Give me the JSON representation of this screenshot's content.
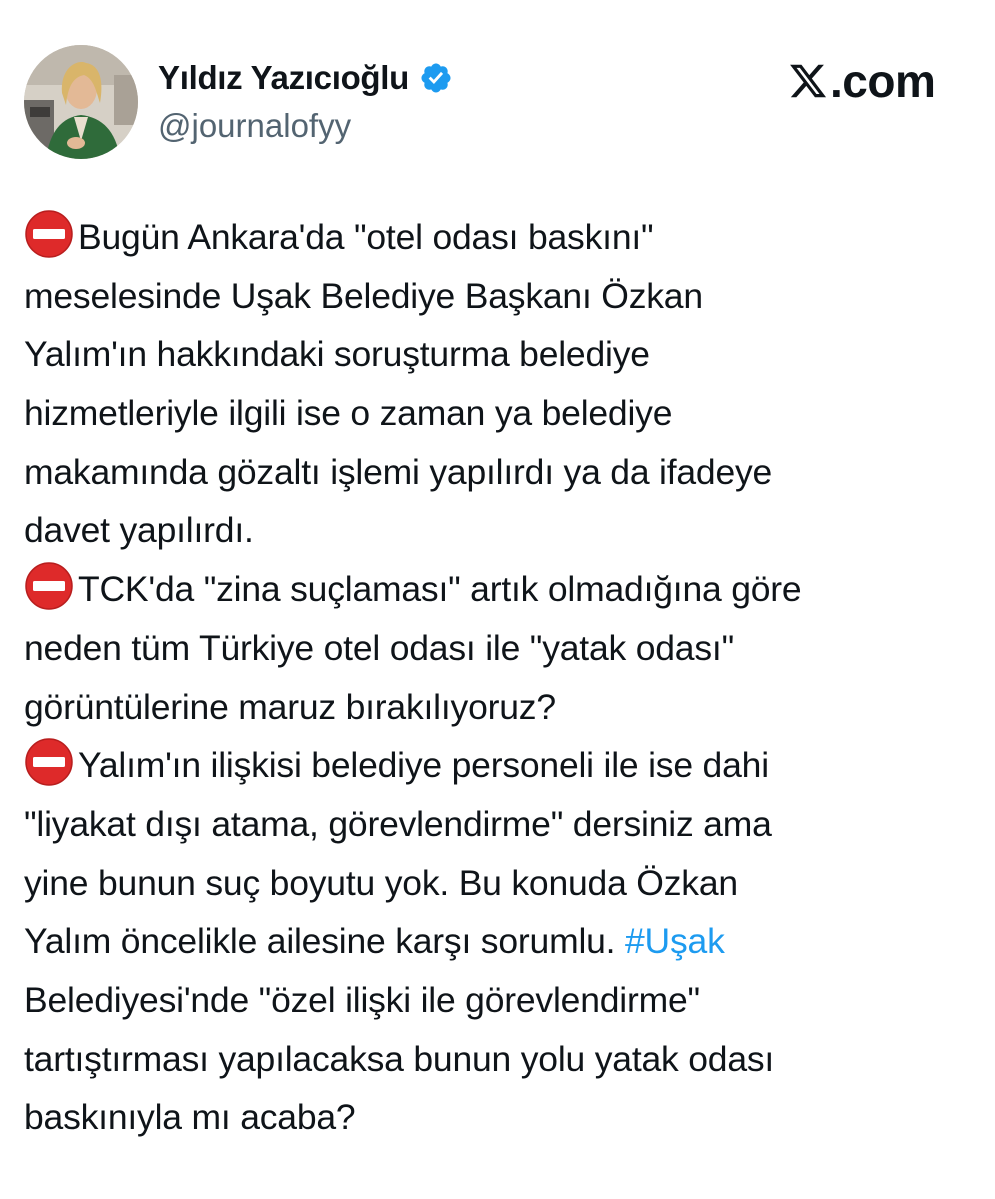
{
  "author": {
    "name": "Yıldız Yazıcıoğlu",
    "handle": "@journalofyy",
    "verified": true,
    "verified_color": "#1d9bf0",
    "avatar_icon": "profile-photo"
  },
  "brand": {
    "logo_icon": "x-logo",
    "text": ".com"
  },
  "tweet": {
    "stop_icon": "no-entry-emoji",
    "lines": [
      "Bugün Ankara'da \"otel odası baskını\"",
      "meselesinde Uşak Belediye Başkanı Özkan",
      "Yalım'ın hakkındaki soruşturma belediye",
      "hizmetleriyle ilgili ise o zaman ya belediye",
      "makamında gözaltı işlemi yapılırdı ya da ifadeye",
      "davet yapılırdı.",
      "TCK'da \"zina suçlaması\" artık olmadığına göre",
      "neden tüm Türkiye otel odası ile \"yatak odası\"",
      "görüntülerine maruz bırakılıyoruz?",
      "Yalım'ın ilişkisi belediye personeli ile ise dahi",
      "\"liyakat dışı atama, görevlendirme\" dersiniz ama",
      "yine bunun suç boyutu yok. Bu konuda Özkan",
      "Yalım öncelikle ailesine karşı sorumlu. ",
      "Belediyesi'nde \"özel ilişki ile görevlendirme\"",
      "tartıştırması yapılacaksa bunun yolu yatak odası",
      "baskınıyla mı acaba?"
    ],
    "hashtag": "#Uşak",
    "hashtag_color": "#1d9bf0"
  }
}
